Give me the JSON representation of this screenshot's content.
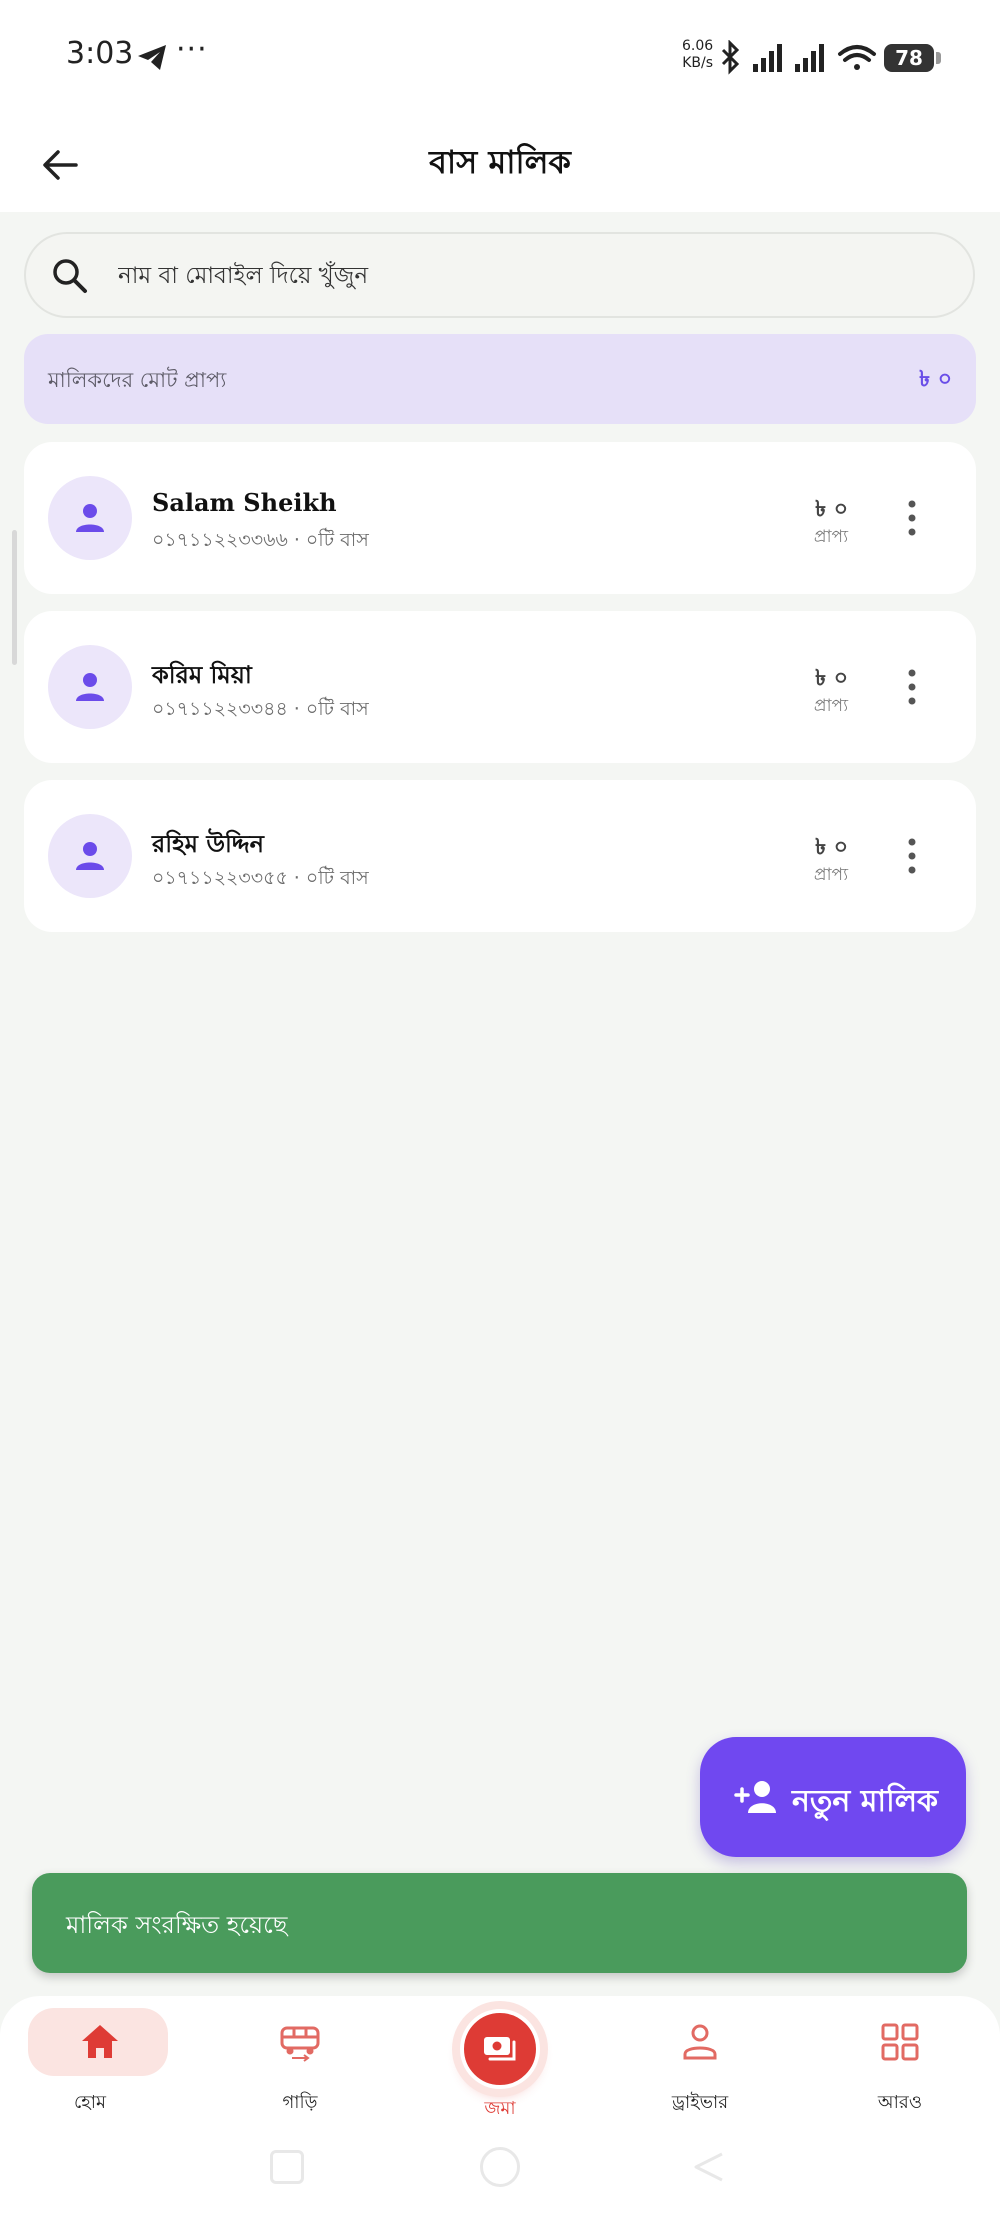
{
  "status_bar": {
    "time": "3:03",
    "dots": "···",
    "net_speed_value": "6.06",
    "net_speed_unit": "KB/s",
    "battery": "78"
  },
  "header": {
    "title": "বাস মালিক"
  },
  "search": {
    "placeholder": "নাম বা মোবাইল দিয়ে খুঁজুন",
    "value": ""
  },
  "summary": {
    "label": "মালিকদের মোট প্রাপ্য",
    "value": "৳ ০"
  },
  "owners": [
    {
      "name": "Salam Sheikh",
      "meta": "০১৭১১২২৩৩৬৬ · ০টি বাস",
      "amount": "৳ ০",
      "amount_label": "প্রাপ্য"
    },
    {
      "name": "করিম মিয়া",
      "meta": "০১৭১১২২৩৩৪৪ · ০টি বাস",
      "amount": "৳ ০",
      "amount_label": "প্রাপ্য"
    },
    {
      "name": "রহিম উদ্দিন",
      "meta": "০১৭১১২২৩৩৫৫ · ০টি বাস",
      "amount": "৳ ০",
      "amount_label": "প্রাপ্য"
    }
  ],
  "fab": {
    "label": "নতুন মালিক"
  },
  "snackbar": {
    "message": "মালিক সংরক্ষিত হয়েছে"
  },
  "bottom_nav": {
    "home": "হোম",
    "vehicles": "গাড়ি",
    "deposit": "জমা",
    "driver": "ড্রাইভার",
    "more": "আরও"
  },
  "colors": {
    "primary": "#7048f0",
    "accent_red": "#de3b35",
    "success": "#4a9b5c",
    "summary_bg": "#e6e0f8"
  }
}
